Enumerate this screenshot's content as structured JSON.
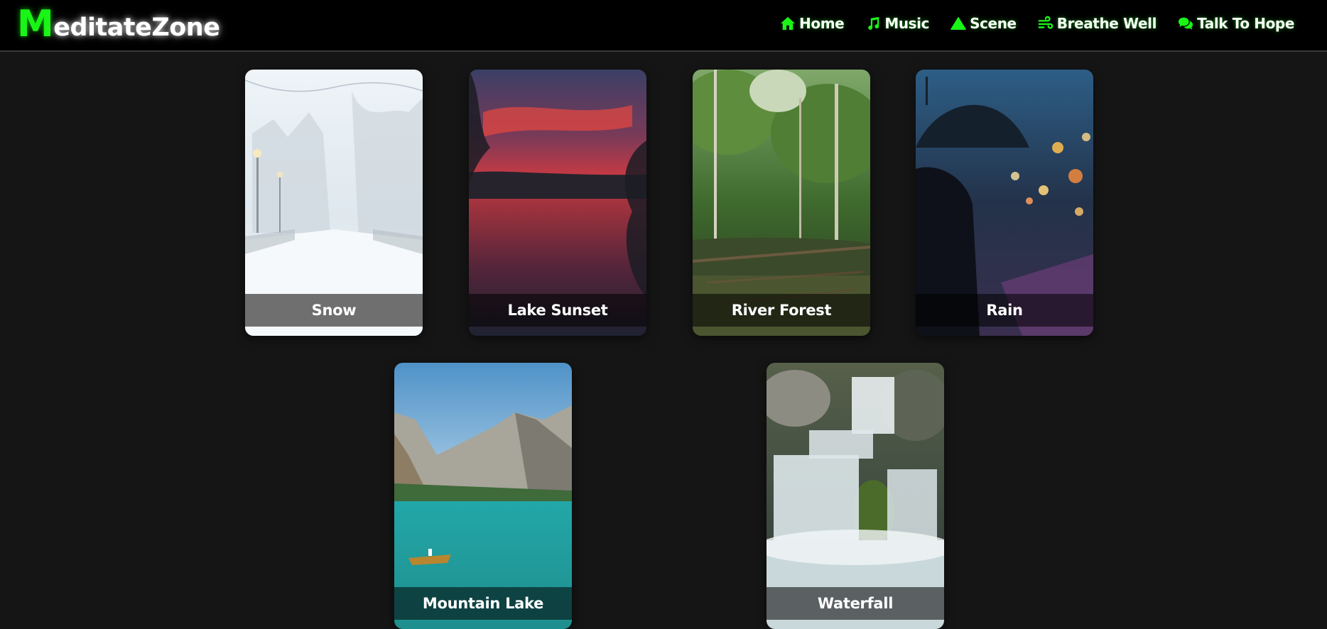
{
  "brand": {
    "first_letter": "M",
    "rest": "editateZone",
    "accent_color": "#19f516"
  },
  "nav": {
    "items": [
      {
        "label": "Home",
        "icon": "home-icon"
      },
      {
        "label": "Music",
        "icon": "music-note-icon"
      },
      {
        "label": "Scene",
        "icon": "triangle-icon"
      },
      {
        "label": "Breathe Well",
        "icon": "wind-icon"
      },
      {
        "label": "Talk To Hope",
        "icon": "chat-bubbles-icon"
      }
    ]
  },
  "scenes": [
    {
      "title": "Snow",
      "image": "snowy-street-image"
    },
    {
      "title": "Lake Sunset",
      "image": "lake-sunset-image"
    },
    {
      "title": "River Forest",
      "image": "river-forest-image"
    },
    {
      "title": "Rain",
      "image": "rain-umbrella-image"
    },
    {
      "title": "Mountain Lake",
      "image": "mountain-lake-image"
    },
    {
      "title": "Waterfall",
      "image": "waterfall-image"
    }
  ],
  "colors": {
    "background": "#151515",
    "navbar": "#000000",
    "accent": "#19f516"
  }
}
